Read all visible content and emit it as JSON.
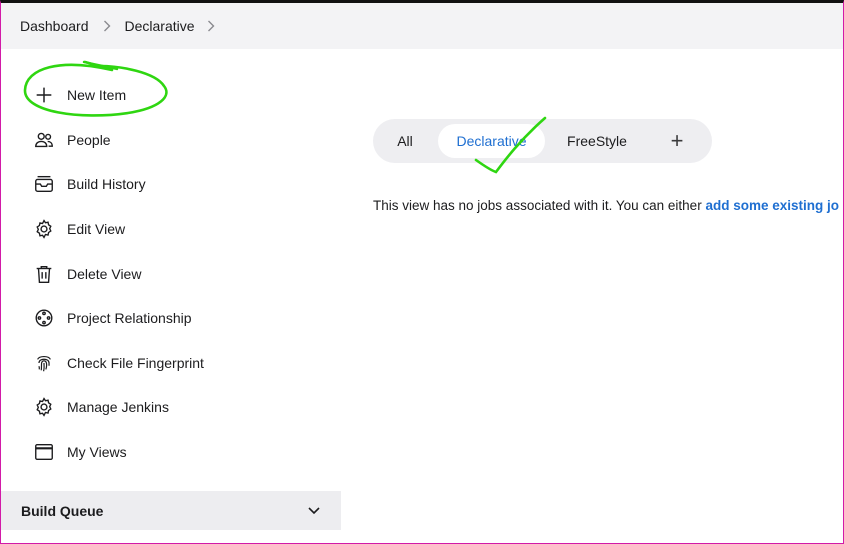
{
  "breadcrumb": {
    "items": [
      "Dashboard",
      "Declarative"
    ]
  },
  "sidebar": {
    "items": [
      {
        "label": "New Item",
        "icon": "plus-icon"
      },
      {
        "label": "People",
        "icon": "people-icon"
      },
      {
        "label": "Build History",
        "icon": "build-history-icon"
      },
      {
        "label": "Edit View",
        "icon": "gear-icon"
      },
      {
        "label": "Delete View",
        "icon": "trash-icon"
      },
      {
        "label": "Project Relationship",
        "icon": "relationship-icon"
      },
      {
        "label": "Check File Fingerprint",
        "icon": "fingerprint-icon"
      },
      {
        "label": "Manage Jenkins",
        "icon": "gear-icon"
      },
      {
        "label": "My Views",
        "icon": "window-icon"
      }
    ]
  },
  "build_queue": {
    "title": "Build Queue"
  },
  "tabs": {
    "items": [
      "All",
      "Declarative",
      "FreeStyle"
    ],
    "active": "Declarative",
    "add_label": "+"
  },
  "main": {
    "empty_text": "This view has no jobs associated with it. You can either ",
    "empty_link": "add some existing jo"
  },
  "colors": {
    "accent": "#1f6fd1",
    "annotation": "#2fd611",
    "breadcrumb_bg": "#f3f3f5",
    "tabbar_bg": "#eeeef1"
  }
}
